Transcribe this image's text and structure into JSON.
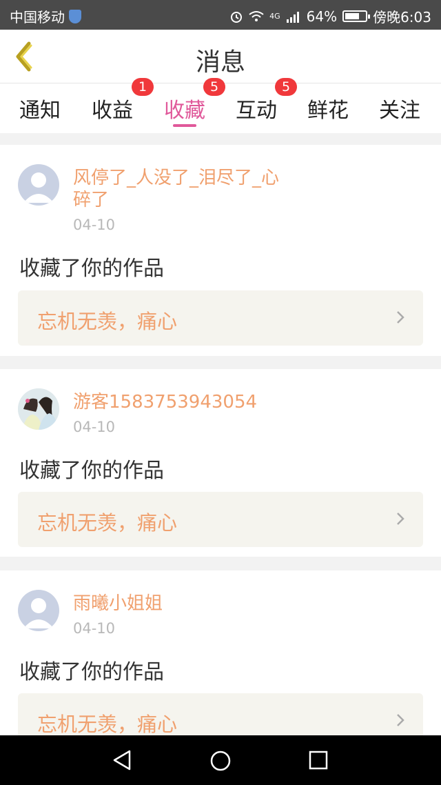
{
  "status_bar": {
    "carrier": "中国移动",
    "network": "4G",
    "battery": "64%",
    "time": "傍晚6:03"
  },
  "header": {
    "title": "消息"
  },
  "tabs": [
    {
      "label": "通知",
      "badge": ""
    },
    {
      "label": "收益",
      "badge": "1"
    },
    {
      "label": "收藏",
      "badge": "5"
    },
    {
      "label": "互动",
      "badge": "5"
    },
    {
      "label": "鲜花",
      "badge": ""
    },
    {
      "label": "关注",
      "badge": ""
    }
  ],
  "messages": [
    {
      "name": "风停了_人没了_泪尽了_心碎了",
      "date": "04-10",
      "action": "收藏了你的作品",
      "work": "忘机无羡，痛心"
    },
    {
      "name": "游客1583753943054",
      "date": "04-10",
      "action": "收藏了你的作品",
      "work": "忘机无羡，痛心"
    },
    {
      "name": "雨曦小姐姐",
      "date": "04-10",
      "action": "收藏了你的作品",
      "work": "忘机无羡，痛心"
    }
  ],
  "colors": {
    "accent": "#e0589a",
    "name_color": "#f0a06e",
    "badge": "#f0383b"
  }
}
